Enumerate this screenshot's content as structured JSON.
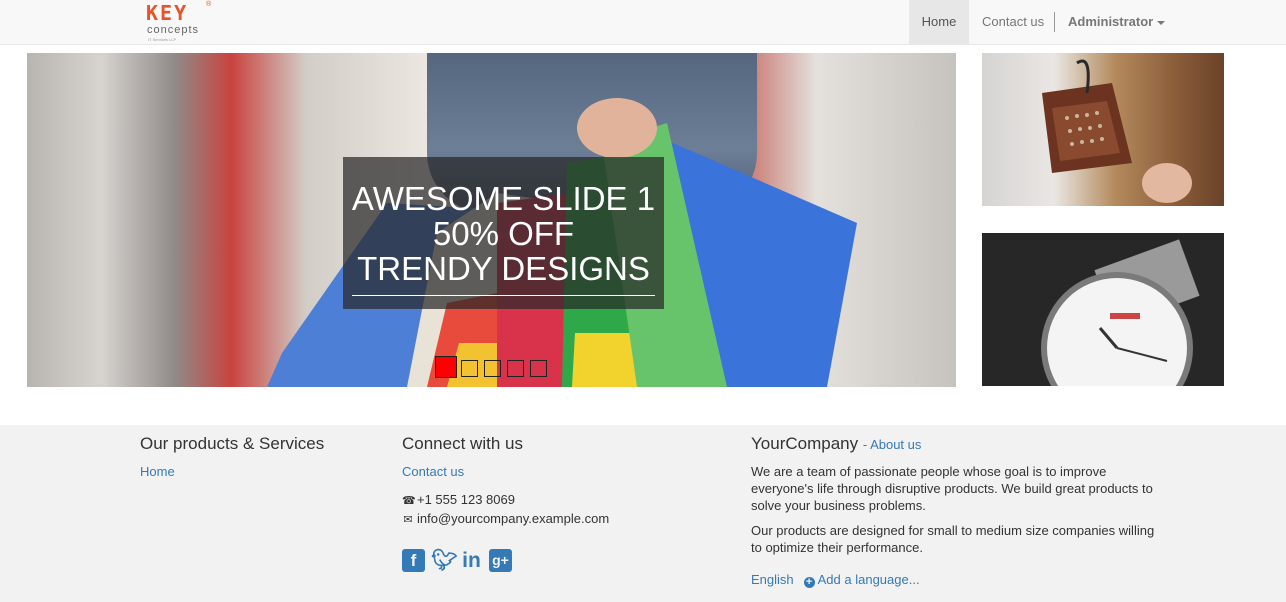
{
  "brand": {
    "logo_top": "KEY",
    "logo_bottom": "concepts",
    "logo_tag": "IT Services LLP",
    "accent": "#e8542a"
  },
  "nav": {
    "items": [
      {
        "label": "Home",
        "active": true
      },
      {
        "label": "Contact us",
        "active": false
      }
    ],
    "user_menu": "Administrator"
  },
  "carousel": {
    "caption_lines": [
      "AWESOME SLIDE 1",
      "50% OFF",
      "TRENDY DESIGNS"
    ],
    "slide_count": 5,
    "active_index": 0,
    "indicator_active_color": "#ff0000"
  },
  "side_images": [
    {
      "alt": "handbag-image"
    },
    {
      "alt": "watch-image"
    }
  ],
  "footer": {
    "products": {
      "title": "Our products & Services",
      "links": [
        "Home"
      ]
    },
    "connect": {
      "title": "Connect with us",
      "contact_link": "Contact us",
      "phone": "+1 555 123 8069",
      "email": "info@yourcompany.example.com",
      "social": [
        "facebook-icon",
        "twitter-icon",
        "linkedin-icon",
        "google-plus-icon"
      ]
    },
    "company": {
      "name": "YourCompany",
      "about_link": "- About us",
      "para1": "We are a team of passionate people whose goal is to improve everyone's life through disruptive products. We build great products to solve your business problems.",
      "para2": "Our products are designed for small to medium size companies willing to optimize their performance.",
      "language": "English",
      "add_language": "Add a language..."
    }
  }
}
